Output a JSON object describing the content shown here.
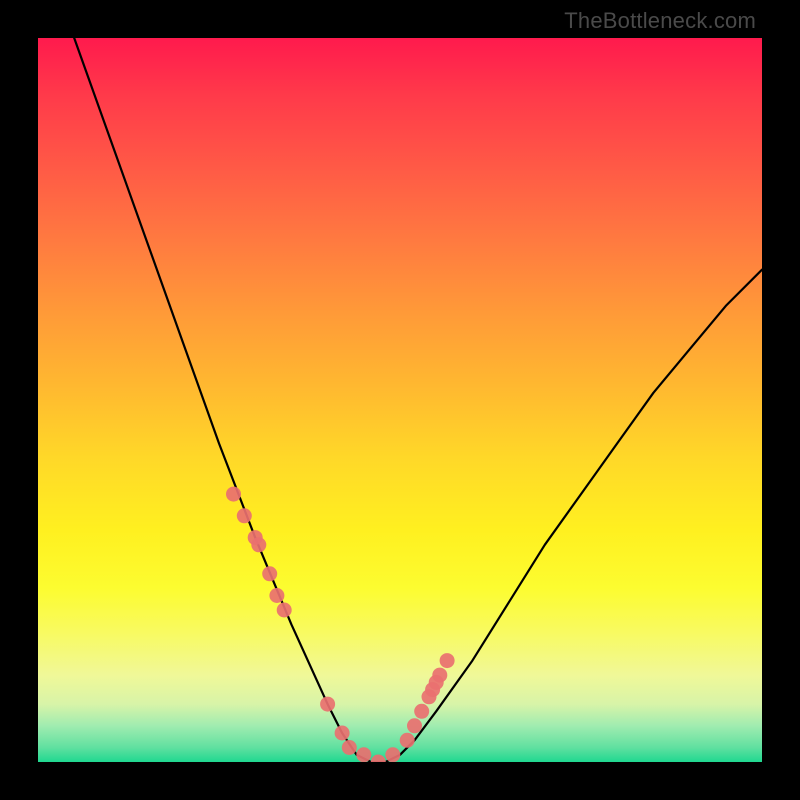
{
  "watermark": "TheBottleneck.com",
  "chart_data": {
    "type": "line",
    "title": "",
    "xlabel": "",
    "ylabel": "",
    "xlim": [
      0,
      100
    ],
    "ylim": [
      0,
      100
    ],
    "series": [
      {
        "name": "bottleneck-curve",
        "x": [
          5,
          10,
          15,
          20,
          25,
          30,
          35,
          40,
          42,
          44,
          46,
          48,
          50,
          52,
          55,
          60,
          65,
          70,
          75,
          80,
          85,
          90,
          95,
          100
        ],
        "values": [
          100,
          86,
          72,
          58,
          44,
          31,
          19,
          8,
          4,
          1,
          0,
          0,
          1,
          3,
          7,
          14,
          22,
          30,
          37,
          44,
          51,
          57,
          63,
          68
        ]
      }
    ],
    "markers": {
      "name": "data-points",
      "x": [
        27,
        28.5,
        30,
        30.5,
        32,
        33,
        34,
        40,
        42,
        43,
        45,
        47,
        49,
        51,
        52,
        53,
        54,
        55,
        54.5,
        55.5,
        56.5
      ],
      "y": [
        37,
        34,
        31,
        30,
        26,
        23,
        21,
        8,
        4,
        2,
        1,
        0,
        1,
        3,
        5,
        7,
        9,
        11,
        10,
        12,
        14
      ]
    },
    "gradient_background": {
      "top_color": "#ff1a4d",
      "bottom_color": "#20d890",
      "type": "vertical"
    }
  }
}
